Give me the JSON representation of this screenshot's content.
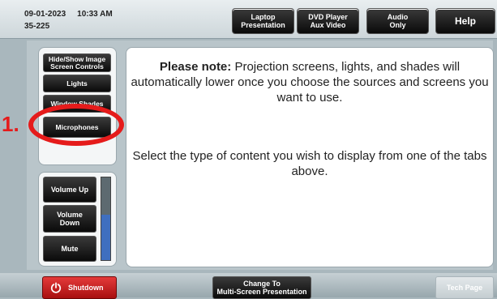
{
  "header": {
    "date": "09-01-2023",
    "time": "10:33 AM",
    "room": "35-225",
    "tabs": [
      {
        "label_line1": "Laptop",
        "label_line2": "Presentation"
      },
      {
        "label_line1": "DVD Player",
        "label_line2": "Aux Video"
      },
      {
        "label_line1": "Audio",
        "label_line2": "Only"
      }
    ],
    "help_label": "Help"
  },
  "sidebar": {
    "buttons": [
      {
        "label_line1": "Hide/Show Image",
        "label_line2": "Screen Controls"
      },
      {
        "label": "Lights"
      },
      {
        "label": "Window Shades"
      },
      {
        "label": "Microphones"
      }
    ],
    "volume": {
      "up_label": "Volume Up",
      "down_line1": "Volume",
      "down_line2": "Down",
      "mute_label": "Mute",
      "level_fraction": 0.55
    }
  },
  "content": {
    "note_bold": "Please note:",
    "note_text": "Projection screens, lights, and shades will automatically lower once you choose the sources and screens you want to use.",
    "select_text": "Select the type of content you wish to display from one of the tabs above."
  },
  "annotation": {
    "number": "1.",
    "color": "#e51b1b"
  },
  "footer": {
    "shutdown_label": "Shutdown",
    "change_line1": "Change To",
    "change_line2": "Multi-Screen Presentation",
    "tech_label": "Tech Page"
  }
}
